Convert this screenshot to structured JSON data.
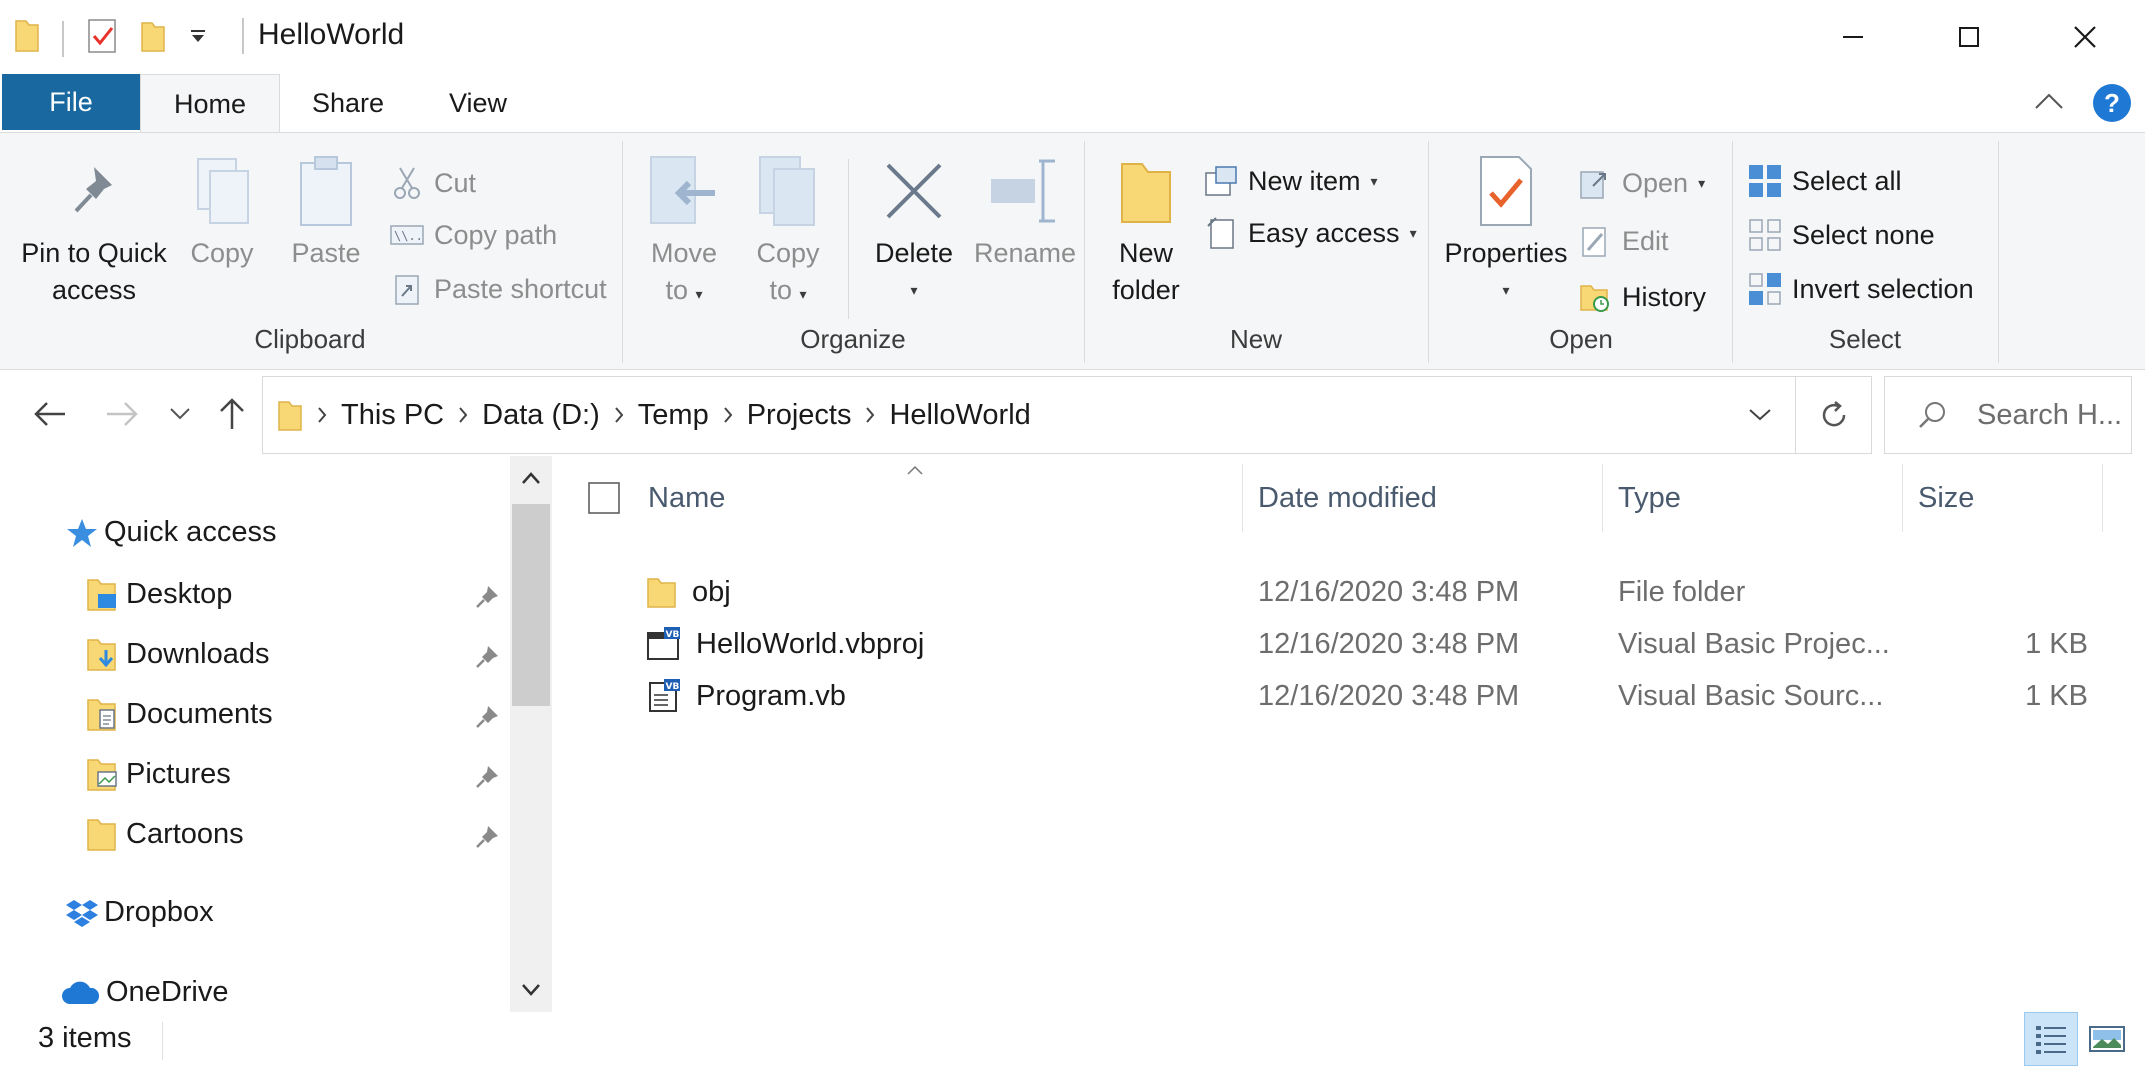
{
  "window": {
    "title": "HelloWorld",
    "minimize_label": "Minimize",
    "maximize_label": "Maximize",
    "close_label": "Close"
  },
  "ribbon_tabs": {
    "file": "File",
    "home": "Home",
    "share": "Share",
    "view": "View",
    "help": "?"
  },
  "clipboard": {
    "group_label": "Clipboard",
    "pin_line1": "Pin to Quick",
    "pin_line2": "access",
    "copy": "Copy",
    "paste": "Paste",
    "cut": "Cut",
    "copy_path": "Copy path",
    "paste_shortcut": "Paste shortcut"
  },
  "organize": {
    "group_label": "Organize",
    "move_line1": "Move",
    "move_line2": "to",
    "copy_line1": "Copy",
    "copy_line2": "to",
    "delete": "Delete",
    "rename": "Rename"
  },
  "new_group": {
    "group_label": "New",
    "new_folder_line1": "New",
    "new_folder_line2": "folder",
    "new_item": "New item",
    "easy_access": "Easy access"
  },
  "open_group": {
    "group_label": "Open",
    "properties": "Properties",
    "open": "Open",
    "edit": "Edit",
    "history": "History"
  },
  "select_group": {
    "group_label": "Select",
    "select_all": "Select all",
    "select_none": "Select none",
    "invert_selection": "Invert selection"
  },
  "address": {
    "crumbs": [
      "This PC",
      "Data (D:)",
      "Temp",
      "Projects",
      "HelloWorld"
    ]
  },
  "search": {
    "placeholder": "Search H..."
  },
  "nav_pane": {
    "quick_access": "Quick access",
    "items": [
      {
        "label": "Desktop",
        "pinned": true
      },
      {
        "label": "Downloads",
        "pinned": true
      },
      {
        "label": "Documents",
        "pinned": true
      },
      {
        "label": "Pictures",
        "pinned": true
      },
      {
        "label": "Cartoons",
        "pinned": true
      }
    ],
    "dropbox": "Dropbox",
    "onedrive": "OneDrive"
  },
  "file_list": {
    "columns": {
      "name": "Name",
      "date_modified": "Date modified",
      "type": "Type",
      "size": "Size"
    },
    "rows": [
      {
        "name": "obj",
        "date": "12/16/2020 3:48 PM",
        "type": "File folder",
        "size": "",
        "icon": "folder-icon"
      },
      {
        "name": "HelloWorld.vbproj",
        "date": "12/16/2020 3:48 PM",
        "type": "Visual Basic Projec...",
        "size": "1 KB",
        "icon": "vbproj-file-icon"
      },
      {
        "name": "Program.vb",
        "date": "12/16/2020 3:48 PM",
        "type": "Visual Basic Sourc...",
        "size": "1 KB",
        "icon": "vb-source-file-icon"
      }
    ]
  },
  "status": {
    "item_count": "3 items"
  },
  "colors": {
    "file_tab": "#19689f",
    "ribbon_bg": "#f5f6f7",
    "folder_yellow": "#f8d775",
    "accent_blue": "#1e78d4",
    "properties_check": "#e8622c"
  }
}
